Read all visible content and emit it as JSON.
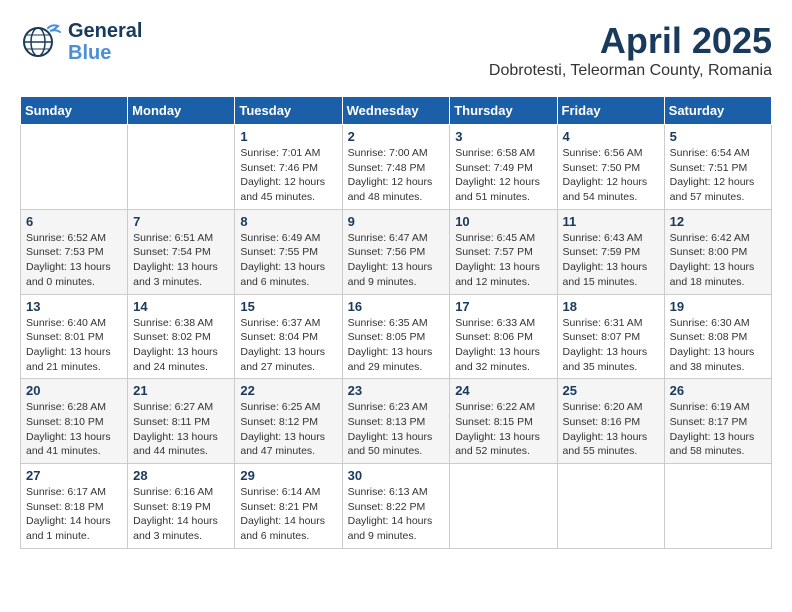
{
  "logo": {
    "line1": "General",
    "line2": "Blue"
  },
  "title": "April 2025",
  "location": "Dobrotesti, Teleorman County, Romania",
  "weekdays": [
    "Sunday",
    "Monday",
    "Tuesday",
    "Wednesday",
    "Thursday",
    "Friday",
    "Saturday"
  ],
  "weeks": [
    [
      {
        "day": "",
        "info": ""
      },
      {
        "day": "",
        "info": ""
      },
      {
        "day": "1",
        "info": "Sunrise: 7:01 AM\nSunset: 7:46 PM\nDaylight: 12 hours\nand 45 minutes."
      },
      {
        "day": "2",
        "info": "Sunrise: 7:00 AM\nSunset: 7:48 PM\nDaylight: 12 hours\nand 48 minutes."
      },
      {
        "day": "3",
        "info": "Sunrise: 6:58 AM\nSunset: 7:49 PM\nDaylight: 12 hours\nand 51 minutes."
      },
      {
        "day": "4",
        "info": "Sunrise: 6:56 AM\nSunset: 7:50 PM\nDaylight: 12 hours\nand 54 minutes."
      },
      {
        "day": "5",
        "info": "Sunrise: 6:54 AM\nSunset: 7:51 PM\nDaylight: 12 hours\nand 57 minutes."
      }
    ],
    [
      {
        "day": "6",
        "info": "Sunrise: 6:52 AM\nSunset: 7:53 PM\nDaylight: 13 hours\nand 0 minutes."
      },
      {
        "day": "7",
        "info": "Sunrise: 6:51 AM\nSunset: 7:54 PM\nDaylight: 13 hours\nand 3 minutes."
      },
      {
        "day": "8",
        "info": "Sunrise: 6:49 AM\nSunset: 7:55 PM\nDaylight: 13 hours\nand 6 minutes."
      },
      {
        "day": "9",
        "info": "Sunrise: 6:47 AM\nSunset: 7:56 PM\nDaylight: 13 hours\nand 9 minutes."
      },
      {
        "day": "10",
        "info": "Sunrise: 6:45 AM\nSunset: 7:57 PM\nDaylight: 13 hours\nand 12 minutes."
      },
      {
        "day": "11",
        "info": "Sunrise: 6:43 AM\nSunset: 7:59 PM\nDaylight: 13 hours\nand 15 minutes."
      },
      {
        "day": "12",
        "info": "Sunrise: 6:42 AM\nSunset: 8:00 PM\nDaylight: 13 hours\nand 18 minutes."
      }
    ],
    [
      {
        "day": "13",
        "info": "Sunrise: 6:40 AM\nSunset: 8:01 PM\nDaylight: 13 hours\nand 21 minutes."
      },
      {
        "day": "14",
        "info": "Sunrise: 6:38 AM\nSunset: 8:02 PM\nDaylight: 13 hours\nand 24 minutes."
      },
      {
        "day": "15",
        "info": "Sunrise: 6:37 AM\nSunset: 8:04 PM\nDaylight: 13 hours\nand 27 minutes."
      },
      {
        "day": "16",
        "info": "Sunrise: 6:35 AM\nSunset: 8:05 PM\nDaylight: 13 hours\nand 29 minutes."
      },
      {
        "day": "17",
        "info": "Sunrise: 6:33 AM\nSunset: 8:06 PM\nDaylight: 13 hours\nand 32 minutes."
      },
      {
        "day": "18",
        "info": "Sunrise: 6:31 AM\nSunset: 8:07 PM\nDaylight: 13 hours\nand 35 minutes."
      },
      {
        "day": "19",
        "info": "Sunrise: 6:30 AM\nSunset: 8:08 PM\nDaylight: 13 hours\nand 38 minutes."
      }
    ],
    [
      {
        "day": "20",
        "info": "Sunrise: 6:28 AM\nSunset: 8:10 PM\nDaylight: 13 hours\nand 41 minutes."
      },
      {
        "day": "21",
        "info": "Sunrise: 6:27 AM\nSunset: 8:11 PM\nDaylight: 13 hours\nand 44 minutes."
      },
      {
        "day": "22",
        "info": "Sunrise: 6:25 AM\nSunset: 8:12 PM\nDaylight: 13 hours\nand 47 minutes."
      },
      {
        "day": "23",
        "info": "Sunrise: 6:23 AM\nSunset: 8:13 PM\nDaylight: 13 hours\nand 50 minutes."
      },
      {
        "day": "24",
        "info": "Sunrise: 6:22 AM\nSunset: 8:15 PM\nDaylight: 13 hours\nand 52 minutes."
      },
      {
        "day": "25",
        "info": "Sunrise: 6:20 AM\nSunset: 8:16 PM\nDaylight: 13 hours\nand 55 minutes."
      },
      {
        "day": "26",
        "info": "Sunrise: 6:19 AM\nSunset: 8:17 PM\nDaylight: 13 hours\nand 58 minutes."
      }
    ],
    [
      {
        "day": "27",
        "info": "Sunrise: 6:17 AM\nSunset: 8:18 PM\nDaylight: 14 hours\nand 1 minute."
      },
      {
        "day": "28",
        "info": "Sunrise: 6:16 AM\nSunset: 8:19 PM\nDaylight: 14 hours\nand 3 minutes."
      },
      {
        "day": "29",
        "info": "Sunrise: 6:14 AM\nSunset: 8:21 PM\nDaylight: 14 hours\nand 6 minutes."
      },
      {
        "day": "30",
        "info": "Sunrise: 6:13 AM\nSunset: 8:22 PM\nDaylight: 14 hours\nand 9 minutes."
      },
      {
        "day": "",
        "info": ""
      },
      {
        "day": "",
        "info": ""
      },
      {
        "day": "",
        "info": ""
      }
    ]
  ]
}
